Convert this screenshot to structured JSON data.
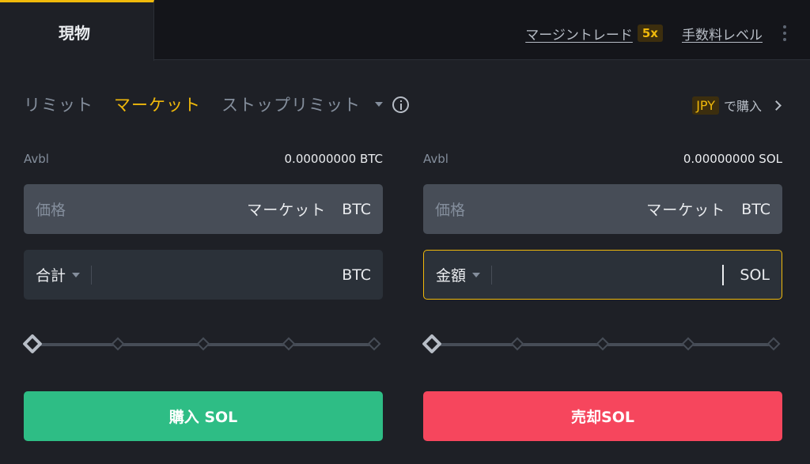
{
  "header": {
    "tab_spot": "現物",
    "margin_link": "マージントレード",
    "leverage": "5x",
    "fee_link": "手数料レベル"
  },
  "order_types": {
    "limit": "リミット",
    "market": "マーケット",
    "stop_limit": "ストップリミット",
    "selected": "マーケット"
  },
  "buy_with": {
    "currency": "JPY",
    "label": "で購入"
  },
  "buy_panel": {
    "avbl_label": "Avbl",
    "avbl_value": "0.00000000 BTC",
    "price_label": "価格",
    "price_value": "マーケット",
    "price_unit": "BTC",
    "total_select": "合計",
    "total_value": "",
    "total_unit": "BTC",
    "slider_percent": 0,
    "button_label": "購入 SOL"
  },
  "sell_panel": {
    "avbl_label": "Avbl",
    "avbl_value": "0.00000000 SOL",
    "price_label": "価格",
    "price_value": "マーケット",
    "price_unit": "BTC",
    "amount_select": "金額",
    "amount_value": "",
    "amount_unit": "SOL",
    "slider_percent": 0,
    "button_label": "売却SOL"
  },
  "colors": {
    "accent": "#f0b90b",
    "buy": "#2ebd85",
    "sell": "#f6465d",
    "background": "#1e2026"
  }
}
